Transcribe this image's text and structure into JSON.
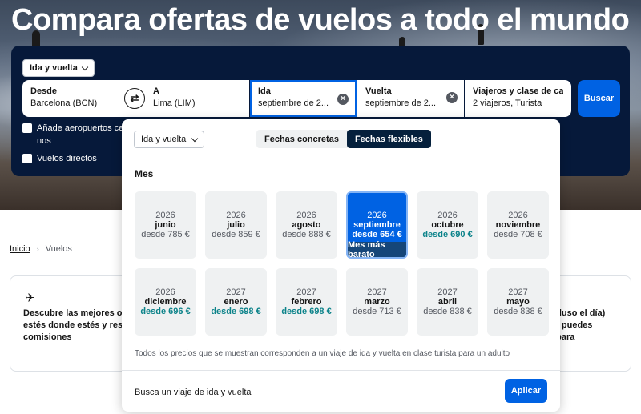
{
  "hero": {
    "title": "Compara ofertas de vuelos a todo el mundo"
  },
  "search": {
    "trip_type": "Ida y vuelta",
    "from": {
      "label": "Desde",
      "value": "Barcelona (BCN)"
    },
    "to": {
      "label": "A",
      "value": "Lima (LIM)"
    },
    "depart": {
      "label": "Ida",
      "value": "septiembre de 2..."
    },
    "return": {
      "label": "Vuelta",
      "value": "septiembre de 2..."
    },
    "travelers": {
      "label": "Viajeros y clase de ca...",
      "value": "2 viajeros, Turista"
    },
    "search_button": "Buscar",
    "nearby_airports": "Añade aeropuertos cercanos",
    "nearby_airports_tail": "nos",
    "direct_flights": "Vuelos directos"
  },
  "breadcrumb": {
    "home": "Inicio",
    "current": "Vuelos"
  },
  "info_card": {
    "left_lines": [
      "Descubre las mejores of",
      "estés donde estés y res",
      "comisiones"
    ],
    "right_lines": [
      "ncluso el día)",
      "én puedes",
      "s para"
    ]
  },
  "datepicker": {
    "trip_type": "Ida y vuelta",
    "tabs": [
      "Fechas concretas",
      "Fechas flexibles"
    ],
    "active_tab": "Fechas flexibles",
    "section_title": "Mes",
    "months": [
      {
        "year": "2026",
        "month": "junio",
        "price": "desde 785 €",
        "cheap": false,
        "selected": false
      },
      {
        "year": "2026",
        "month": "julio",
        "price": "desde 859 €",
        "cheap": false,
        "selected": false
      },
      {
        "year": "2026",
        "month": "agosto",
        "price": "desde 888 €",
        "cheap": false,
        "selected": false
      },
      {
        "year": "2026",
        "month": "septiembre",
        "price": "desde 654 €",
        "cheap": true,
        "selected": true,
        "badge": "Mes más barato"
      },
      {
        "year": "2026",
        "month": "octubre",
        "price": "desde 690 €",
        "cheap": true,
        "selected": false
      },
      {
        "year": "2026",
        "month": "noviembre",
        "price": "desde 708 €",
        "cheap": false,
        "selected": false
      },
      {
        "year": "2026",
        "month": "diciembre",
        "price": "desde 696 €",
        "cheap": true,
        "selected": false
      },
      {
        "year": "2027",
        "month": "enero",
        "price": "desde 698 €",
        "cheap": true,
        "selected": false
      },
      {
        "year": "2027",
        "month": "febrero",
        "price": "desde 698 €",
        "cheap": true,
        "selected": false
      },
      {
        "year": "2027",
        "month": "marzo",
        "price": "desde 713 €",
        "cheap": false,
        "selected": false
      },
      {
        "year": "2027",
        "month": "abril",
        "price": "desde 838 €",
        "cheap": false,
        "selected": false
      },
      {
        "year": "2027",
        "month": "mayo",
        "price": "desde 838 €",
        "cheap": false,
        "selected": false
      }
    ],
    "note": "Todos los precios que se muestran corresponden a un viaje de ida y vuelta en clase turista para un adulto",
    "footer_text": "Busca un viaje de ida y vuelta",
    "apply_button": "Aplicar"
  },
  "colors": {
    "primary": "#0062e3",
    "panel": "#06193a",
    "cheap_price": "#0c838a",
    "badge": "#154679"
  }
}
